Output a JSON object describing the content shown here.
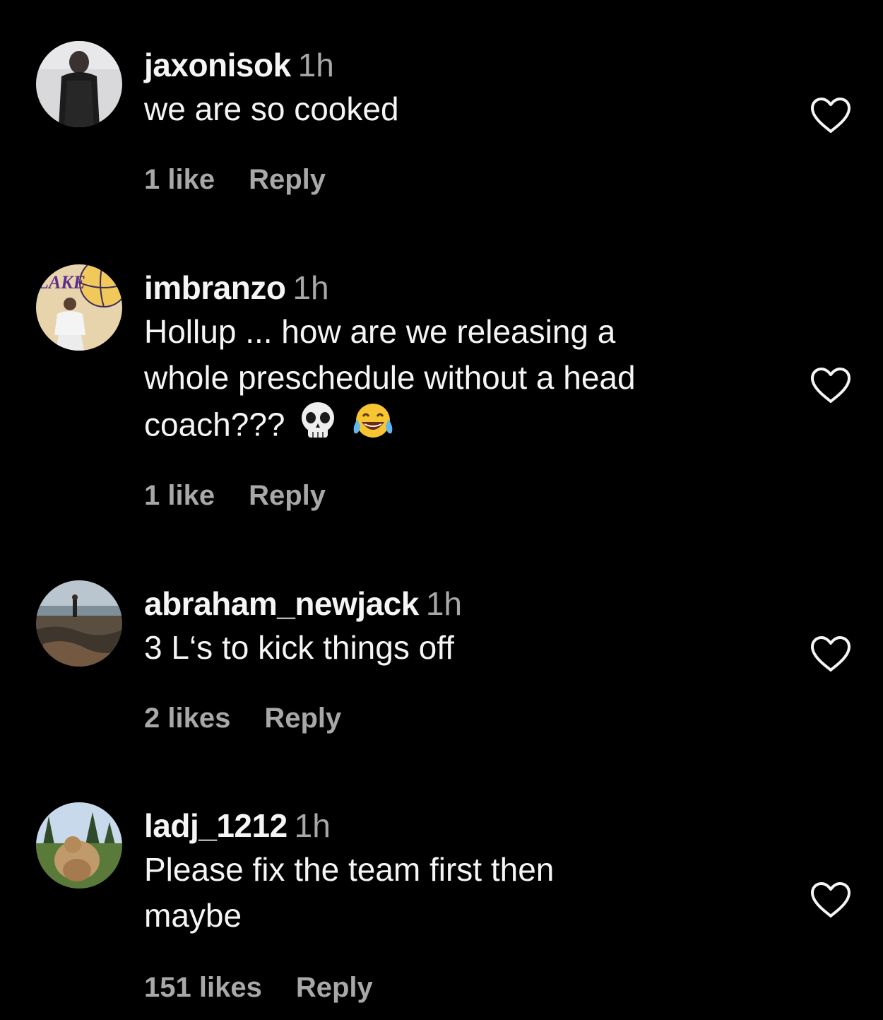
{
  "comments": [
    {
      "username": "jaxonisok",
      "time": "1h",
      "text": "we are so cooked",
      "likes": "1 like",
      "reply_label": "Reply",
      "emojis": []
    },
    {
      "username": "imbranzo",
      "time": "1h",
      "text": "Hollup ... how are we releasing a\nwhole preschedule without a head\ncoach???",
      "likes": "1 like",
      "reply_label": "Reply",
      "emojis": [
        "skull-emoji",
        "tears-of-joy-emoji"
      ]
    },
    {
      "username": "abraham_newjack",
      "time": "1h",
      "text": "3 L‘s to kick things off",
      "likes": "2 likes",
      "reply_label": "Reply",
      "emojis": []
    },
    {
      "username": "ladj_1212",
      "time": "1h",
      "text": "Please fix the team first then\nmaybe",
      "likes": "151 likes",
      "reply_label": "Reply",
      "emojis": []
    }
  ],
  "icons": {
    "like": "heart-outline-icon"
  },
  "colors": {
    "background": "#000000",
    "primary_text": "#f5f5f5",
    "secondary_text": "#a8a8a8"
  }
}
